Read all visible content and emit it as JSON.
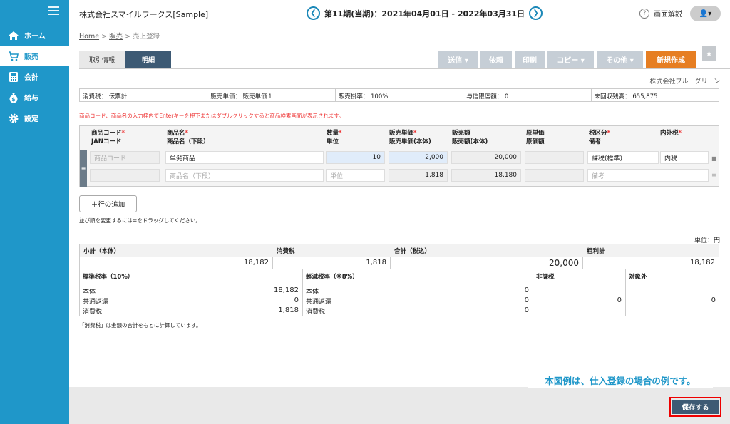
{
  "sidebar": {
    "items": [
      {
        "label": "ホーム",
        "icon": "home-icon"
      },
      {
        "label": "販売",
        "icon": "cart-icon"
      },
      {
        "label": "会計",
        "icon": "calculator-icon"
      },
      {
        "label": "給与",
        "icon": "moneybag-icon"
      },
      {
        "label": "設定",
        "icon": "gear-icon"
      }
    ]
  },
  "header": {
    "company": "株式会社スマイルワークス[Sample]",
    "period": "第11期(当期)：2021年04月01日 - 2022年03月31日",
    "help": "画面解説"
  },
  "breadcrumb": {
    "home": "Home",
    "sep1": ">",
    "sales": "販売",
    "sep2": ">",
    "current": "売上登録"
  },
  "tabs": [
    "取引情報",
    "明細"
  ],
  "actions": {
    "send": "送信 ▾",
    "request": "依頼",
    "print": "印刷",
    "copy": "コピー ▾",
    "other": "その他 ▾",
    "new": "新規作成"
  },
  "customer": "株式会社ブルーグリーン",
  "info": {
    "tax": "消費税： 伝票計",
    "unit_price": "販売単価： 販売単価１",
    "rate": "販売掛率： 100%",
    "credit": "与信限度額： 0",
    "unpaid": "未回収残高： 655,875"
  },
  "notice": "商品コード、商品名の入力枠内でEnterキーを押下またはダブルクリックすると商品検索画面が表示されます。",
  "grid": {
    "headers": {
      "code": "商品コード",
      "jan": "JANコード",
      "name": "商品名",
      "name2": "商品名（下段）",
      "qty": "数量",
      "unit": "単位",
      "price": "販売単価",
      "price_net": "販売単価(本体)",
      "amount": "販売額",
      "amount_net": "販売額(本体)",
      "cost": "原単価",
      "cost_amount": "原価額",
      "taxcat": "税区分",
      "note": "備考",
      "incl": "内外税",
      "required": "*"
    },
    "row": {
      "code_ph": "商品コード",
      "name": "単発商品",
      "name2_ph": "商品名（下段）",
      "qty": "10",
      "unit_ph": "単位",
      "price": "2,000",
      "price_net": "1,818",
      "amount": "20,000",
      "amount_net": "18,180",
      "taxcat": "課税(標準)",
      "note_ph": "備考",
      "incl": "内税"
    }
  },
  "add_row": "＋行の追加",
  "drag_hint": "並び順を変更するには=をドラッグしてください。",
  "unit_label": "単位：円",
  "summary": {
    "subtotal_label": "小計（本体）",
    "subtotal": "18,182",
    "tax_label": "消費税",
    "tax": "1,818",
    "total_label": "合計（税込）",
    "total": "20,000",
    "gross_label": "粗利計",
    "gross": "18,182"
  },
  "taxes": {
    "standard": {
      "title": "標準税率（10%）",
      "base_label": "本体",
      "base": "18,182",
      "common_label": "共通返還",
      "common": "0",
      "tax_label": "消費税",
      "tax": "1,818"
    },
    "reduced": {
      "title": "軽減税率（※8%）",
      "base_label": "本体",
      "base": "0",
      "common_label": "共通返還",
      "common": "0",
      "tax_label": "消費税",
      "tax": "0"
    },
    "exempt": {
      "title": "非課税",
      "value": "0"
    },
    "outside": {
      "title": "対象外",
      "value": "0"
    }
  },
  "footnote": "「消費税」は金額の合計をもとに計算しています。",
  "callout": "本図例は、仕入登録の場合の例です。",
  "save": "保存する"
}
